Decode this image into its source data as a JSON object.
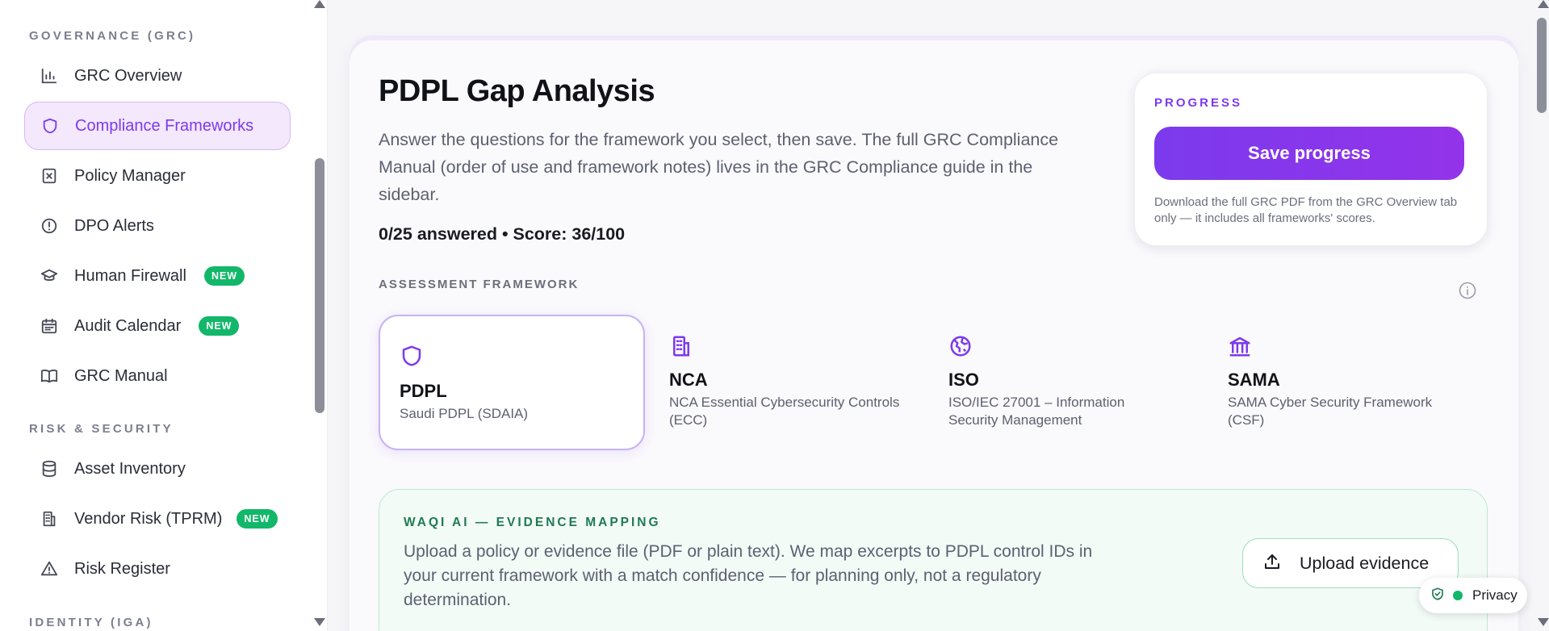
{
  "sidebar": {
    "sections": [
      {
        "label": "GOVERNANCE (GRC)"
      },
      {
        "label": "RISK & SECURITY"
      },
      {
        "label": "IDENTITY (IGA)"
      }
    ],
    "items": [
      {
        "label": "GRC Overview",
        "icon": "bar-chart-icon"
      },
      {
        "label": "Compliance Frameworks",
        "icon": "shield-icon",
        "active": true
      },
      {
        "label": "Policy Manager",
        "icon": "document-x-icon"
      },
      {
        "label": "DPO Alerts",
        "icon": "alert-circle-icon"
      },
      {
        "label": "Human Firewall",
        "icon": "graduation-cap-icon",
        "badge": "NEW"
      },
      {
        "label": "Audit Calendar",
        "icon": "calendar-icon",
        "badge": "NEW"
      },
      {
        "label": "GRC Manual",
        "icon": "book-icon"
      },
      {
        "label": "Asset Inventory",
        "icon": "database-icon"
      },
      {
        "label": "Vendor Risk (TPRM)",
        "icon": "building-icon",
        "badge": "NEW"
      },
      {
        "label": "Risk Register",
        "icon": "warning-icon"
      }
    ]
  },
  "main": {
    "title": "PDPL Gap Analysis",
    "description": "Answer the questions for the framework you select, then save. The full GRC Compliance Manual (order of use and framework notes) lives in the GRC Compliance guide in the sidebar.",
    "stats": "0/25 answered • Score: 36/100",
    "progress": {
      "label": "PROGRESS",
      "save_label": "Save progress",
      "note": "Download the full GRC PDF from the GRC Overview tab only — it includes all frameworks' scores."
    },
    "framework_label": "ASSESSMENT FRAMEWORK",
    "frameworks": [
      {
        "name": "PDPL",
        "subtitle": "Saudi PDPL (SDAIA)",
        "icon": "shield-icon",
        "selected": true
      },
      {
        "name": "NCA",
        "subtitle": "NCA Essential Cybersecurity Controls (ECC)",
        "icon": "building-icon"
      },
      {
        "name": "ISO",
        "subtitle": "ISO/IEC 27001 – Information Security Management",
        "icon": "globe-icon"
      },
      {
        "name": "SAMA",
        "subtitle": "SAMA Cyber Security Framework (CSF)",
        "icon": "bank-icon"
      }
    ],
    "evidence": {
      "label": "WAQI AI — EVIDENCE MAPPING",
      "text": "Upload a policy or evidence file (PDF or plain text). We map excerpts to PDPL control IDs in your current framework with a match confidence — for planning only, not a regulatory determination.",
      "upload_label": "Upload evidence"
    }
  },
  "privacy": {
    "label": "Privacy"
  },
  "colors": {
    "accent": "#7c3aed",
    "badge_green": "#12b76a",
    "evidence_green": "#1f7a53"
  }
}
